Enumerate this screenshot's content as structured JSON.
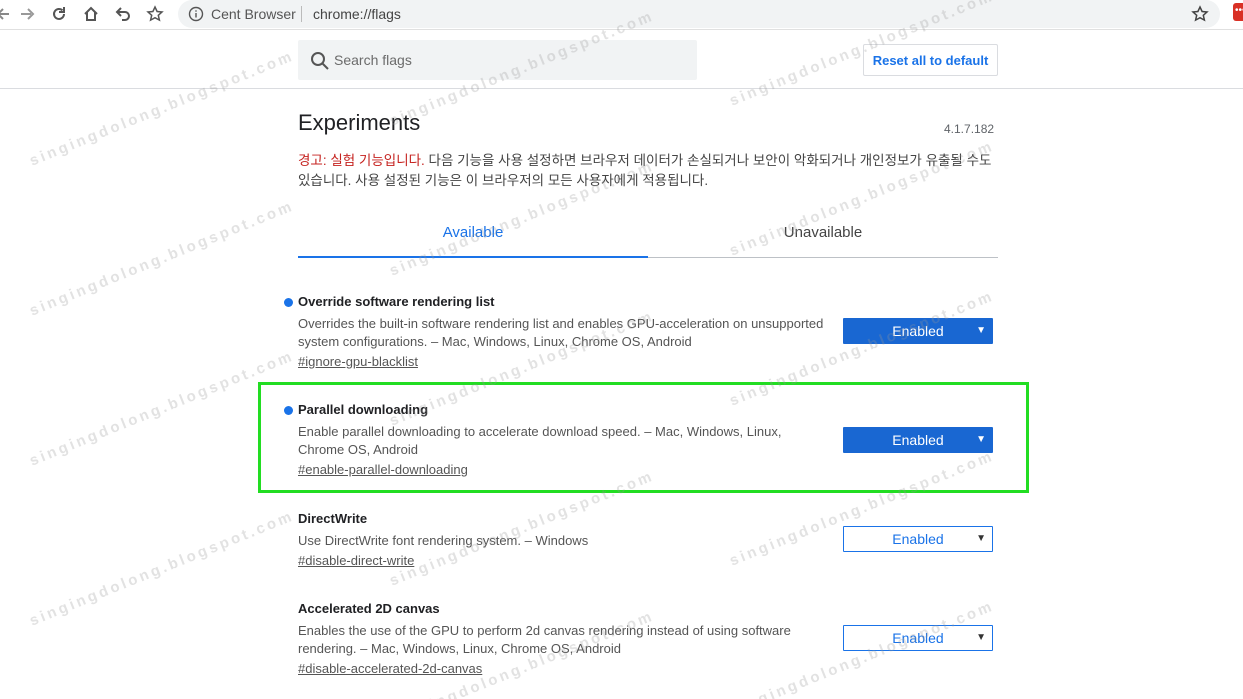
{
  "browser": {
    "site_name": "Cent Browser",
    "url": "chrome://flags",
    "ext_badge": "•••"
  },
  "header": {
    "search_placeholder": "Search flags",
    "reset_label": "Reset all to default"
  },
  "content": {
    "title": "Experiments",
    "version": "4.1.7.182",
    "warning_prefix": "경고: 실험 기능입니다.",
    "warning_text": " 다음 기능을 사용 설정하면 브라우저 데이터가 손실되거나 보안이 악화되거나 개인정보가 유출될 수도 있습니다. 사용 설정된 기능은 이 브라우저의 모든 사용자에게 적용됩니다."
  },
  "tabs": [
    {
      "label": "Available"
    },
    {
      "label": "Unavailable"
    }
  ],
  "flags": [
    {
      "name": "Override software rendering list",
      "description": "Overrides the built-in software rendering list and enables GPU-acceleration on unsupported system configurations. – Mac, Windows, Linux, Chrome OS, Android",
      "link": "#ignore-gpu-blacklist",
      "value": "Enabled",
      "modified": true
    },
    {
      "name": "Parallel downloading",
      "description": "Enable parallel downloading to accelerate download speed. – Mac, Windows, Linux, Chrome OS, Android",
      "link": "#enable-parallel-downloading",
      "value": "Enabled",
      "modified": true
    },
    {
      "name": "DirectWrite",
      "description": "Use DirectWrite font rendering system. – Windows",
      "link": "#disable-direct-write",
      "value": "Enabled",
      "modified": false
    },
    {
      "name": "Accelerated 2D canvas",
      "description": "Enables the use of the GPU to perform 2d canvas rendering instead of using software rendering. – Mac, Windows, Linux, Chrome OS, Android",
      "link": "#disable-accelerated-2d-canvas",
      "value": "Enabled",
      "modified": false
    }
  ],
  "dropdown_arrow": "▼",
  "watermark_text": "singingdolong.blogspot.com",
  "colors": {
    "accent": "#1a73e8",
    "enabled_fill": "#1967d2",
    "highlight_border": "#22dd22",
    "warning_red": "#c5221f"
  }
}
